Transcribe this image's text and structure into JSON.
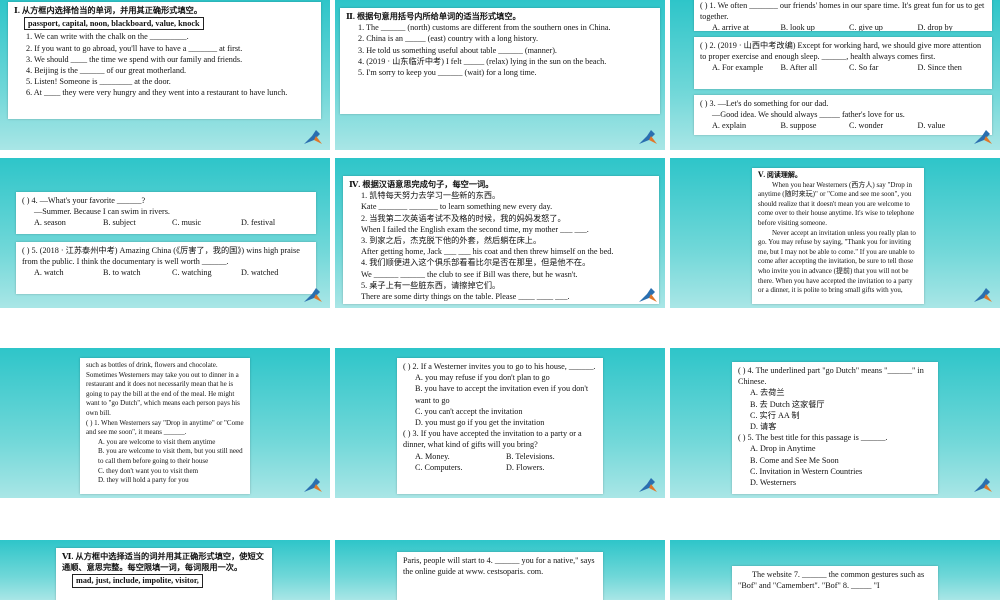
{
  "slides": [
    {
      "id": "s1",
      "heading": "Ⅰ. 从方框内选择恰当的单词，并用其正确形式填空。",
      "wordbox": "passport, capital, noon, blackboard, value, knock",
      "items": [
        "1. We can write with the chalk on the _________.",
        "2. If you want to go abroad, you'll have to have a _______ at first.",
        "3. We should ____ the time we spend with our family and friends.",
        "4. Beijing is the ______ of our great motherland.",
        "5. Listen! Someone is ________ at the door.",
        "6. At ____ they were very hungry and they went into a restaurant to have lunch."
      ]
    },
    {
      "id": "s2",
      "heading": "Ⅱ. 根据句意用括号内所给单词的适当形式填空。",
      "items": [
        "1. The ______ (north) customs are different from the southern ones in China.",
        "2. China is an _____ (east) country with a long history.",
        "3. He told us something useful about table ______ (manner).",
        "4. (2019 · 山东临沂中考) I felt _____ (relax) lying in the sun on the beach.",
        "5. I'm sorry to keep you ______ (wait) for a long time."
      ]
    },
    {
      "id": "s3",
      "top_line": "(   ) 1. We often _______ our friends' homes in our spare time. It's great fun for us to get together.",
      "q1_options": [
        "A. arrive at",
        "B. look up",
        "C. give up",
        "D. drop by"
      ],
      "q2": "(   ) 2. (2019 · 山西中考改编) Except for working hard, we should give more attention to proper exercise and enough sleep. ______, health always comes first.",
      "q2_options": [
        "A. For example",
        "B. After all",
        "C. So far",
        "D. Since then"
      ],
      "q3": "(   ) 3. —Let's do something for our dad.",
      "q3b": "—Good idea. We should always _____ father's love for us.",
      "q3_options": [
        "A. explain",
        "B. suppose",
        "C. wonder",
        "D. value"
      ]
    },
    {
      "id": "s4",
      "q4": "(   ) 4. —What's your favorite ______?",
      "q4b": "—Summer. Because I can swim in rivers.",
      "q4_options": [
        "A. season",
        "B. subject",
        "C. music",
        "D. festival"
      ],
      "q5": "(   ) 5. (2018 · 江苏泰州中考) Amazing China (《厉害了，我的国》) wins high praise from the public. I think the documentary is well worth ______.",
      "q5_options": [
        "A. watch",
        "B. to watch",
        "C. watching",
        "D. watched"
      ]
    },
    {
      "id": "s5",
      "heading": "Ⅳ. 根据汉语意思完成句子，每空一词。",
      "items": [
        "1. 凯特每天努力去学习一些新的东西。",
        "Kate _______ _______ to learn something new every day.",
        "2. 当我第二次英语考试不及格的时候，我的妈妈发怒了。",
        "When I failed the English exam the second time, my mother ___ ___.",
        "3. 到家之后，杰克脱下他的外套，然后躺在床上。",
        "After getting home, Jack ___ ___ his coat and then threw himself on the bed.",
        "4. 我们顺便进入这个俱乐部看看比尔是否在那里，但是他不在。",
        "We ______ ______ the club to see if Bill was there, but he wasn't.",
        "5. 桌子上有一些脏东西，请擦掉它们。",
        "There are some dirty things on the table. Please ____ ____ ___."
      ]
    },
    {
      "id": "s6",
      "heading": "Ⅴ. 阅读理解。",
      "paragraphs": [
        "When you hear Westerners (西方人) say \"Drop in anytime (随时来玩)\" or \"Come and see me soon\", you should realize that it doesn't mean you are welcome to come over to their house anytime. It's wise to telephone before visiting someone.",
        "Never accept an invitation unless you really plan to go. You may refuse by saying, \"Thank you for inviting me, but I may not be able to come.\" If you are unable to come after accepting the invitation, be sure to tell those who invite you in advance (提前) that you will not be there. When you have accepted the invitation to a party or a dinner, it is polite to bring small gifts with you,"
      ]
    },
    {
      "id": "s7",
      "paragraph": "such as bottles of drink, flowers and chocolate. Sometimes Westerners may take you out to dinner in a restaurant and it does not necessarily mean that he is going to pay the bill at the end of the meal. He might want to \"go Dutch\", which means each person pays his own bill.",
      "q1": "(   ) 1. When Westerners say \"Drop in anytime\" or \"Come and see me soon\", it means ______.",
      "q1_options": [
        "A. you are welcome to visit them anytime",
        "B. you are welcome to visit them, but you still need to call them before going to their house",
        "C. they don't want you to visit them",
        "D. they will hold a party for you"
      ]
    },
    {
      "id": "s8",
      "q2": "(   ) 2. If a Westerner invites you to go to his house, ______.",
      "q2_options": [
        "A. you may refuse if you don't plan to go",
        "B. you have to accept the invitation even if you don't want to go",
        "C. you can't accept the invitation",
        "D. you must go if you get the invitation"
      ],
      "q3": "(   ) 3. If you have accepted the invitation to a party or a dinner, what kind of gifts will you bring?",
      "q3_options": [
        "A. Money.",
        "B. Televisions.",
        "C. Computers.",
        "D. Flowers."
      ]
    },
    {
      "id": "s9",
      "q4": "(   ) 4. The underlined part \"go Dutch\" means \"______\" in Chinese.",
      "q4_options": [
        "A. 去荷兰",
        "B. 去 Dutch 这家餐厅",
        "C. 实行 AA 制",
        "D. 请客"
      ],
      "q5": "(   ) 5. The best title for this passage is ______.",
      "q5_options": [
        "A. Drop in Anytime",
        "B. Come and See Me Soon",
        "C. Invitation in Western Countries",
        "D. Westerners"
      ]
    },
    {
      "id": "s10",
      "heading": "Ⅵ. 从方框中选择适当的词并用其正确形式填空，使短文通顺、意思完整。每空限填一词，每词限用一次。",
      "wordbox": "mad, just, include, impolite, visitor,"
    },
    {
      "id": "s11",
      "text": "Paris, people will start to 4. ______ you for a native,\" says the online guide at www. cestsoparis. com."
    },
    {
      "id": "s12",
      "text": "The website 7. ______ the common gestures such as \"Bof\" and \"Camembert\". \"Bof\" 8. _____ \"I"
    }
  ]
}
